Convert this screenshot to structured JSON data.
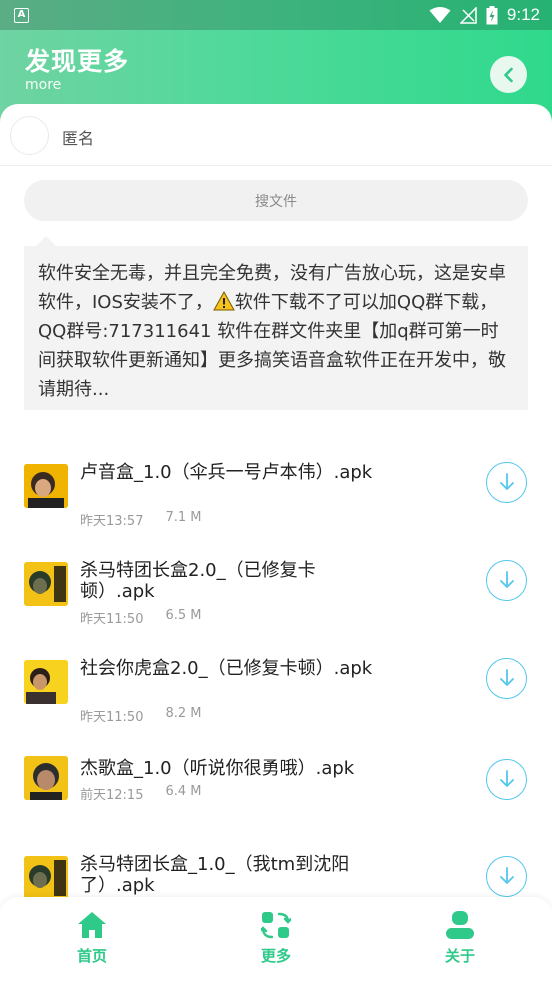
{
  "status_bar": {
    "time": "9:12",
    "app_badge": "A"
  },
  "header": {
    "title": "发现更多",
    "subtitle": "more"
  },
  "user": {
    "name": "匿名"
  },
  "search": {
    "label": "搜文件"
  },
  "notice": {
    "text_before_icon": "软件安全无毒，并且完全免费，没有广告放心玩，这是安卓软件，IOS安装不了，",
    "text_after_icon": "软件下载不了可以加QQ群下载，QQ群号:717311641 软件在群文件夹里【加q群可第一时间获取软件更新通知】更多搞笑语音盒软件正在开发中，敬请期待..."
  },
  "files": [
    {
      "name": "卢音盒_1.0（伞兵一号卢本伟）.apk",
      "time": "昨天13:57",
      "size": "7.1 M"
    },
    {
      "name": "杀马特团长盒2.0_（已修复卡顿）.apk",
      "time": "昨天11:50",
      "size": "6.5 M"
    },
    {
      "name": "社会你虎盒2.0_（已修复卡顿）.apk",
      "time": "昨天11:50",
      "size": "8.2 M"
    },
    {
      "name": "杰歌盒_1.0（听说你很勇哦）.apk",
      "time": "前天12:15",
      "size": "6.4 M"
    },
    {
      "name": "杀马特团长盒_1.0_（我tm到沈阳了）.apk",
      "time": "",
      "size": ""
    }
  ],
  "tabs": [
    {
      "label": "首页",
      "icon": "home-icon"
    },
    {
      "label": "更多",
      "icon": "more-icon"
    },
    {
      "label": "关于",
      "icon": "user-icon"
    }
  ],
  "colors": {
    "accent": "#2fc98a",
    "download": "#53c7ec"
  }
}
